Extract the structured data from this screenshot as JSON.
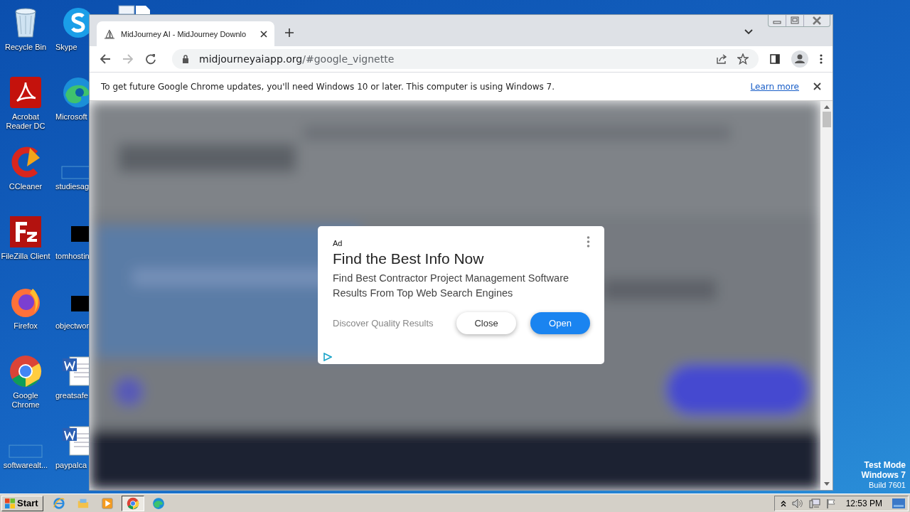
{
  "desktop": {
    "icons": [
      {
        "label": "Recycle Bin",
        "kind": "recycle"
      },
      {
        "label": "Skype",
        "kind": "skype"
      },
      {
        "label": "Acrobat Reader DC",
        "kind": "acrobat"
      },
      {
        "label": "Microsoft",
        "kind": "edge"
      },
      {
        "label": "CCleaner",
        "kind": "ccleaner"
      },
      {
        "label": "studiesag",
        "kind": "blank"
      },
      {
        "label": "FileZilla Client",
        "kind": "filezilla"
      },
      {
        "label": "tomhostin",
        "kind": "black"
      },
      {
        "label": "Firefox",
        "kind": "firefox"
      },
      {
        "label": "objectwor",
        "kind": "black"
      },
      {
        "label": "Google Chrome",
        "kind": "chrome"
      },
      {
        "label": "greatsafe",
        "kind": "word"
      },
      {
        "label": "softwarealt...",
        "kind": "blank"
      },
      {
        "label": "paypalca",
        "kind": "word"
      }
    ],
    "system_text": [
      "Test Mode",
      "Windows 7",
      "Build 7601"
    ]
  },
  "browser": {
    "tab": {
      "title": "MidJourney AI - MidJourney Downlo"
    },
    "address": {
      "host": "midjourneyaiapp.org",
      "path": "/#google_vignette"
    },
    "infobar": {
      "message": "To get future Google Chrome updates, you'll need Windows 10 or later. This computer is using Windows 7.",
      "link": "Learn more"
    },
    "ad": {
      "label": "Ad",
      "title": "Find the Best Info Now",
      "description": "Find Best Contractor Project Management Software Results From Top Web Search Engines",
      "advertiser": "Discover Quality Results",
      "buttons": [
        {
          "label": "Close",
          "kind": "secondary"
        },
        {
          "label": "Open",
          "kind": "primary"
        }
      ]
    }
  },
  "taskbar": {
    "start": "Start",
    "apps": [
      {
        "kind": "ie",
        "selected": false
      },
      {
        "kind": "explorer",
        "selected": false
      },
      {
        "kind": "media",
        "selected": false
      },
      {
        "kind": "chrome",
        "selected": true
      },
      {
        "kind": "edge",
        "selected": false
      }
    ],
    "clock": "12:53 PM"
  }
}
